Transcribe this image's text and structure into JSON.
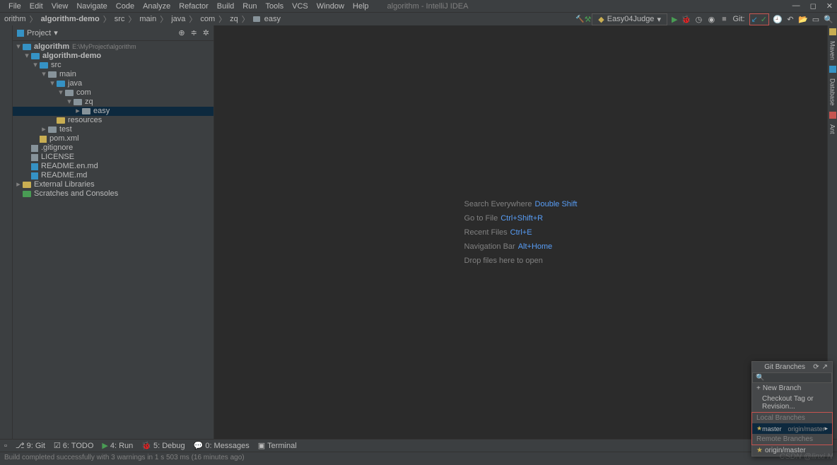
{
  "menu": [
    "File",
    "Edit",
    "View",
    "Navigate",
    "Code",
    "Analyze",
    "Refactor",
    "Build",
    "Run",
    "Tools",
    "VCS",
    "Window",
    "Help"
  ],
  "title": "algorithm - IntelliJ IDEA",
  "breadcrumb": [
    "orithm",
    "algorithm-demo",
    "src",
    "main",
    "java",
    "com",
    "zq",
    "easy"
  ],
  "run_config": "Easy04Judge",
  "git_label": "Git:",
  "project": {
    "header": "Project",
    "root": {
      "name": "algorithm",
      "path": "E:\\MyProject\\algorithm"
    },
    "module": "algorithm-demo",
    "src": "src",
    "main": "main",
    "java": "java",
    "com": "com",
    "zq": "zq",
    "easy": "easy",
    "resources": "resources",
    "test": "test",
    "pom": "pom.xml",
    "gitignore": ".gitignore",
    "license": "LICENSE",
    "readme_en": "README.en.md",
    "readme": "README.md",
    "ext_lib": "External Libraries",
    "scratches": "Scratches and Consoles"
  },
  "welcome": {
    "r1": {
      "label": "Search Everywhere",
      "key": "Double Shift"
    },
    "r2": {
      "label": "Go to File",
      "key": "Ctrl+Shift+R"
    },
    "r3": {
      "label": "Recent Files",
      "key": "Ctrl+E"
    },
    "r4": {
      "label": "Navigation Bar",
      "key": "Alt+Home"
    },
    "r5": "Drop files here to open"
  },
  "right_tools": [
    "Maven",
    "Database",
    "Ant"
  ],
  "bottom_tools": {
    "git": "9: Git",
    "todo": "6: TODO",
    "run": "4: Run",
    "debug": "5: Debug",
    "messages": "0: Messages",
    "terminal": "Terminal"
  },
  "status": "Build completed successfully with 3 warnings in 1 s 503 ms (16 minutes ago)",
  "git_popup": {
    "title": "Git Branches",
    "new_branch": "New Branch",
    "checkout": "Checkout Tag or Revision...",
    "local": "Local Branches",
    "master": "master",
    "master_remote": "origin/master",
    "remote": "Remote Branches",
    "origin_master": "origin/master"
  },
  "watermark": "CSDN @linxi N"
}
